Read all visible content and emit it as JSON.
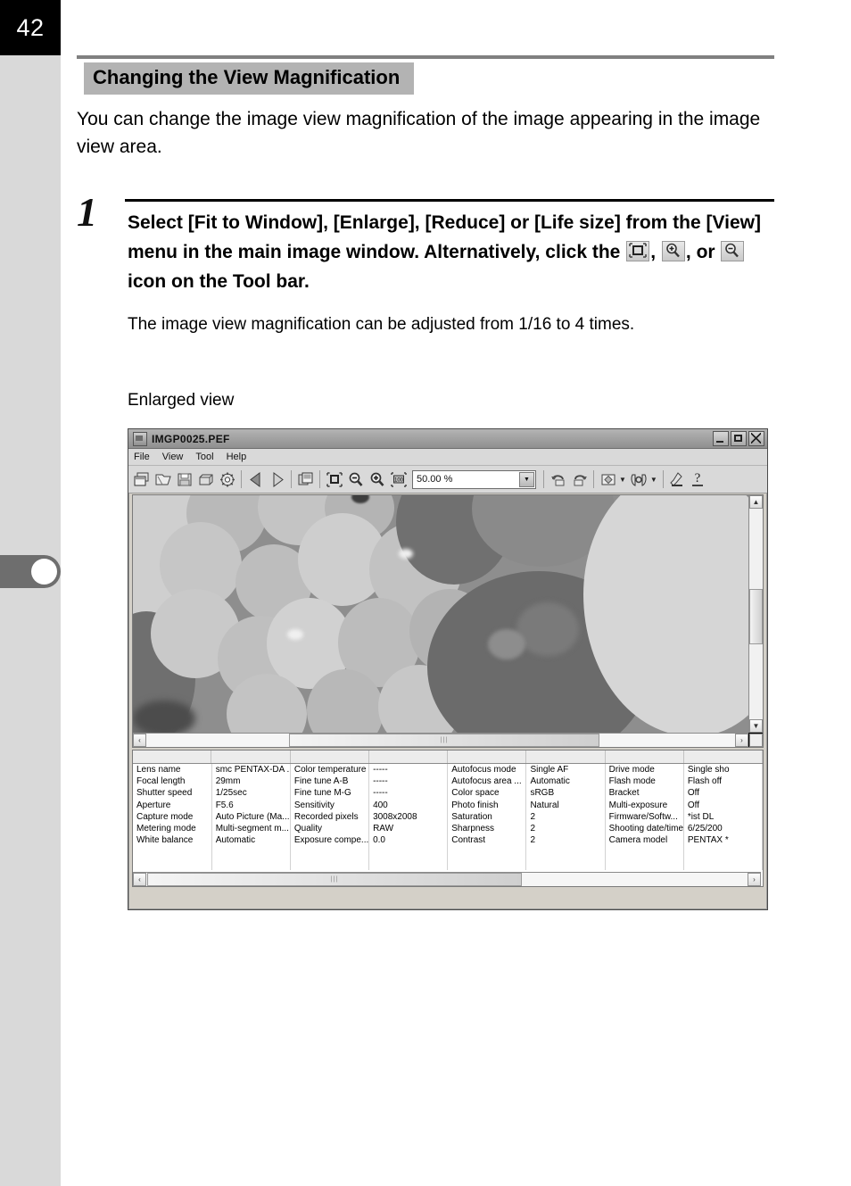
{
  "page": {
    "number": "42"
  },
  "section": {
    "title": "Changing the View Magnification"
  },
  "intro": {
    "text": "You can change the image view magnification of the image appearing in the image view area."
  },
  "step": {
    "number": "1",
    "title_part1": "Select [Fit to Window], [Enlarge], [Reduce] or [Life size] from the [View] menu in the main image window. Alternatively, click the",
    "comma1": ",",
    "comma2": ",",
    "or": "or",
    "title_part2": "icon on the Tool bar.",
    "description": "The image view magnification can be adjusted from 1/16 to 4 times.",
    "icons": [
      "fit-to-window-icon",
      "zoom-in-icon",
      "zoom-out-icon",
      "life-size-icon"
    ]
  },
  "caption": {
    "text": "Enlarged view"
  },
  "app_window": {
    "title": "IMGP0025.PEF",
    "window_buttons": [
      "minimize",
      "maximize",
      "close"
    ],
    "menu": [
      "File",
      "View",
      "Tool",
      "Help"
    ],
    "toolbar": {
      "icons": [
        "new-window-icon",
        "open-folder-icon",
        "save-icon",
        "print-icon",
        "settings-gear-icon",
        "previous-image-icon",
        "next-image-icon",
        "copy-image-icon",
        "fit-to-window-icon",
        "zoom-out-icon",
        "zoom-in-icon",
        "life-size-icon"
      ],
      "zoom_value": "50.00 %",
      "right_icons": [
        "rotate-left-icon",
        "rotate-right-icon",
        "image-adjust-icon",
        "white-balance-icon",
        "tools-icon",
        "help-icon"
      ]
    },
    "scrollbars": {
      "left_arrow": "‹",
      "right_arrow": "›",
      "up_arrow": "▲",
      "down_arrow": "▼",
      "thumb_grip": "|||"
    },
    "metadata_table": {
      "columns": 8,
      "rows": [
        [
          "Lens name",
          "smc PENTAX-DA ...",
          "Color temperature",
          "-----",
          "Autofocus mode",
          "Single AF",
          "Drive mode",
          "Single sho"
        ],
        [
          "Focal length",
          "29mm",
          "Fine tune A-B",
          "-----",
          "Autofocus area ...",
          "Automatic",
          "Flash mode",
          "Flash off"
        ],
        [
          "Shutter speed",
          "1/25sec",
          "Fine tune M-G",
          "-----",
          "Color space",
          "sRGB",
          "Bracket",
          "Off"
        ],
        [
          "Aperture",
          "F5.6",
          "Sensitivity",
          "400",
          "Photo finish",
          "Natural",
          "Multi-exposure",
          "Off"
        ],
        [
          "Capture mode",
          "Auto Picture (Ma...",
          "Recorded pixels",
          "3008x2008",
          "Saturation",
          "2",
          "Firmware/Softw...",
          "*ist DL"
        ],
        [
          "Metering mode",
          "Multi-segment m...",
          "Quality",
          "RAW",
          "Sharpness",
          "2",
          "Shooting date/time",
          "6/25/200"
        ],
        [
          "White balance",
          "Automatic",
          "Exposure compe...",
          "0.0",
          "Contrast",
          "2",
          "Camera model",
          "PENTAX *"
        ]
      ]
    }
  }
}
